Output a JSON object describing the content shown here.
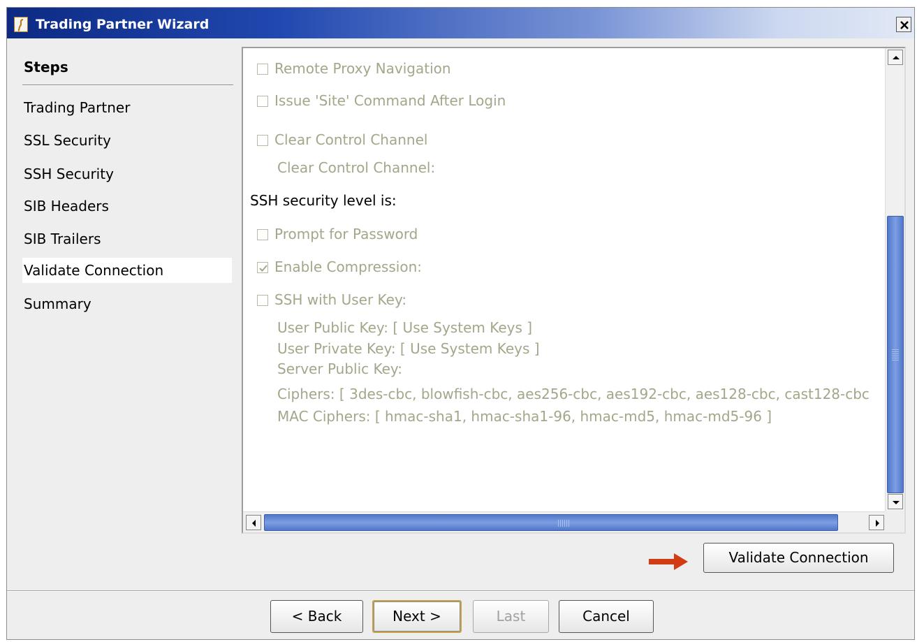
{
  "window": {
    "title": "Trading Partner Wizard",
    "app_icon": "app-logo-icon",
    "close_icon": "close-icon"
  },
  "steps": {
    "heading": "Steps",
    "items": [
      {
        "label": "Trading Partner"
      },
      {
        "label": "SSL Security"
      },
      {
        "label": "SSH Security"
      },
      {
        "label": "SIB Headers"
      },
      {
        "label": "SIB Trailers"
      },
      {
        "label": "Validate Connection",
        "current": true
      },
      {
        "label": "Summary"
      }
    ]
  },
  "options": {
    "remote_proxy": {
      "label": "Remote Proxy Navigation",
      "checked": false
    },
    "issue_site": {
      "label": "Issue 'Site' Command After Login",
      "checked": false
    },
    "clear_control": {
      "label": "Clear Control Channel",
      "checked": false
    },
    "clear_control_value": "Clear Control Channel:",
    "ssh_level_label": "SSH security level is:",
    "prompt_password": {
      "label": "Prompt for Password",
      "checked": false
    },
    "enable_compression": {
      "label": "Enable Compression:",
      "checked": true
    },
    "ssh_user_key": {
      "label": "SSH with User Key:",
      "checked": false
    },
    "user_public_key": "User Public Key: [ Use System Keys ]",
    "user_private_key": "User Private Key: [ Use System Keys ]",
    "server_public_key": "Server Public Key:",
    "ciphers": "Ciphers: [ 3des-cbc, blowfish-cbc, aes256-cbc, aes192-cbc, aes128-cbc, cast128-cbc",
    "mac_ciphers": "MAC Ciphers: [ hmac-sha1, hmac-sha1-96, hmac-md5, hmac-md5-96 ]"
  },
  "buttons": {
    "validate": "Validate Connection",
    "back": "< Back",
    "next": "Next >",
    "last": "Last",
    "cancel": "Cancel"
  },
  "colors": {
    "title_gradient_start": "#0c2a83",
    "disabled_text": "#a3a78a",
    "scroll_thumb": "#6a8ed8",
    "arrow": "#d13c12"
  },
  "annotation_icon": "right-arrow-icon"
}
